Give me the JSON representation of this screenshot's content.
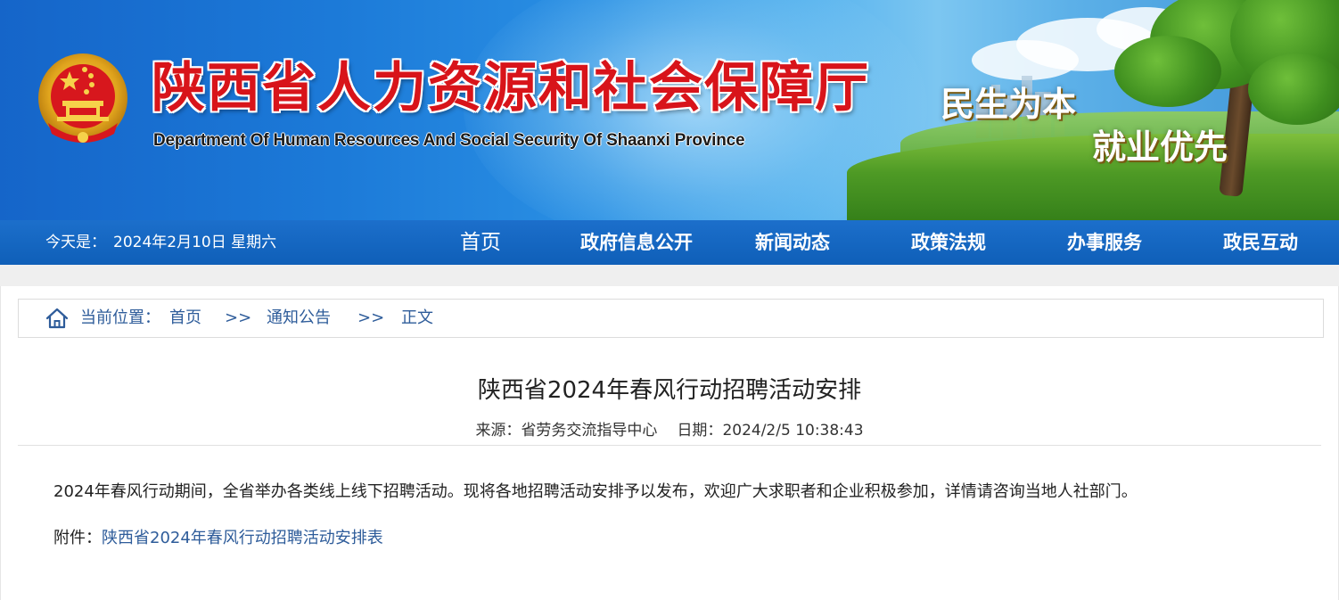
{
  "header": {
    "title_cn": "陕西省人力资源和社会保障厅",
    "title_en": "Department Of Human Resources And Social Security Of Shaanxi Province",
    "slogan_1": "民生为本",
    "slogan_2": "就业优先",
    "emblem_icon": "national-emblem-icon",
    "title_color": "#d8141a"
  },
  "navbar": {
    "today_label": "今天是：",
    "today_value": "2024年2月10日 星期六",
    "items": [
      {
        "label": "首页"
      },
      {
        "label": "政府信息公开"
      },
      {
        "label": "新闻动态"
      },
      {
        "label": "政策法规"
      },
      {
        "label": "办事服务"
      },
      {
        "label": "政民互动"
      }
    ],
    "bg_color": "#0f5fb8"
  },
  "breadcrumb": {
    "icon": "home-icon",
    "prefix": "当前位置：",
    "items": [
      "首页",
      "通知公告",
      "正文"
    ],
    "separator": ">>"
  },
  "article": {
    "title": "陕西省2024年春风行动招聘活动安排",
    "source_label": "来源：",
    "source_value": "省劳务交流指导中心",
    "date_label": "日期：",
    "date_value": "2024/2/5 10:38:43",
    "body": "2024年春风行动期间，全省举办各类线上线下招聘活动。现将各地招聘活动安排予以发布，欢迎广大求职者和企业积极参加，详情请咨询当地人社部门。",
    "attachment_label": "附件：",
    "attachment_link": "陕西省2024年春风行动招聘活动安排表",
    "link_color": "#2e5c9a"
  }
}
